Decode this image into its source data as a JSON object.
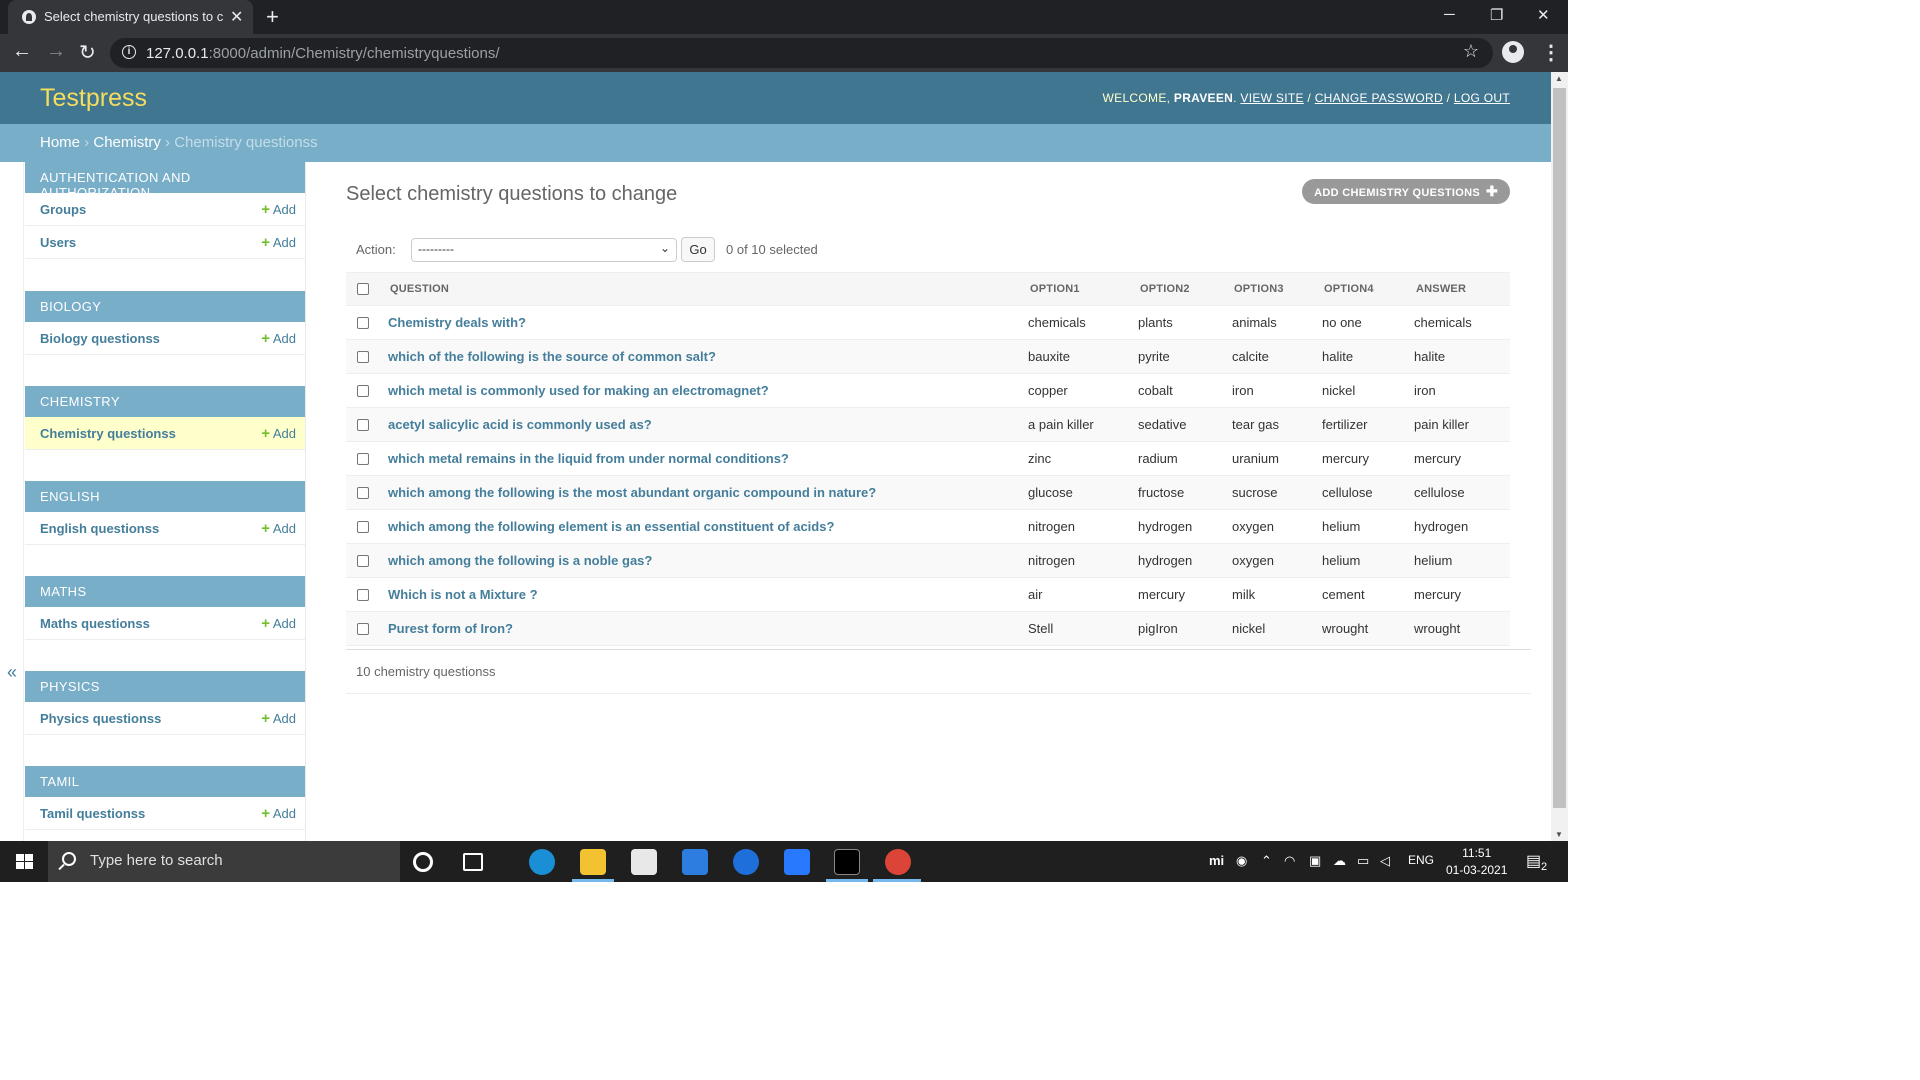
{
  "browser": {
    "tab_title": "Select chemistry questions to cha",
    "url_host": "127.0.0.1",
    "url_path": ":8000/admin/Chemistry/chemistryquestions/"
  },
  "header": {
    "brand": "Testpress",
    "welcome": "WELCOME, ",
    "username": "PRAVEEN",
    "view_site": "VIEW SITE",
    "change_password": "CHANGE PASSWORD",
    "log_out": "LOG OUT"
  },
  "breadcrumbs": {
    "home": "Home",
    "app": "Chemistry",
    "current": "Chemistry questionss"
  },
  "sidebar": {
    "add_label": "Add",
    "modules": [
      {
        "caption": "AUTHENTICATION AND AUTHORIZATION",
        "models": [
          "Groups",
          "Users"
        ]
      },
      {
        "caption": "BIOLOGY",
        "models": [
          "Biology questionss"
        ]
      },
      {
        "caption": "CHEMISTRY",
        "models": [
          "Chemistry questionss"
        ]
      },
      {
        "caption": "ENGLISH",
        "models": [
          "English questionss"
        ]
      },
      {
        "caption": "MATHS",
        "models": [
          "Maths questionss"
        ]
      },
      {
        "caption": "PHYSICS",
        "models": [
          "Physics questionss"
        ]
      },
      {
        "caption": "TAMIL",
        "models": [
          "Tamil questionss"
        ]
      }
    ]
  },
  "content": {
    "title": "Select chemistry questions to change",
    "add_button": "ADD CHEMISTRY QUESTIONS",
    "action_label": "Action:",
    "action_value": "---------",
    "go_label": "Go",
    "selected_counter": "0 of 10 selected",
    "columns": [
      "QUESTION",
      "OPTION1",
      "OPTION2",
      "OPTION3",
      "OPTION4",
      "ANSWER"
    ],
    "rows": [
      [
        "Chemistry deals with?",
        "chemicals",
        "plants",
        "animals",
        "no one",
        "chemicals"
      ],
      [
        "which of the following is the source of common salt?",
        "bauxite",
        "pyrite",
        "calcite",
        "halite",
        "halite"
      ],
      [
        "which metal is commonly used for making an electromagnet?",
        "copper",
        "cobalt",
        "iron",
        "nickel",
        "iron"
      ],
      [
        "acetyl salicylic acid is commonly used as?",
        "a pain killer",
        "sedative",
        "tear gas",
        "fertilizer",
        "pain killer"
      ],
      [
        "which metal remains in the liquid from under normal conditions?",
        "zinc",
        "radium",
        "uranium",
        "mercury",
        "mercury"
      ],
      [
        "which among the following is the most abundant organic compound in nature?",
        "glucose",
        "fructose",
        "sucrose",
        "cellulose",
        "cellulose"
      ],
      [
        "which among the following element is an essential constituent of acids?",
        "nitrogen",
        "hydrogen",
        "oxygen",
        "helium",
        "hydrogen"
      ],
      [
        "which among the following is a noble gas?",
        "nitrogen",
        "hydrogen",
        "oxygen",
        "helium",
        "helium"
      ],
      [
        "Which is not a Mixture ?",
        "air",
        "mercury",
        "milk",
        "cement",
        "mercury"
      ],
      [
        "Purest form of Iron?",
        "Stell",
        "pigIron",
        "nickel",
        "wrought",
        "wrought"
      ]
    ],
    "paginator": "10 chemistry questionss"
  },
  "taskbar": {
    "search_placeholder": "Type here to search",
    "language": "ENG",
    "time": "11:51",
    "date": "01-03-2021",
    "notification_count": "2"
  },
  "colors": {
    "header_bg": "#417690",
    "breadcrumb_bg": "#79aec8",
    "brand": "#f5dd5d",
    "link": "#447e9b",
    "add_plus": "#70bf2b",
    "current_row": "#ffffcc"
  }
}
